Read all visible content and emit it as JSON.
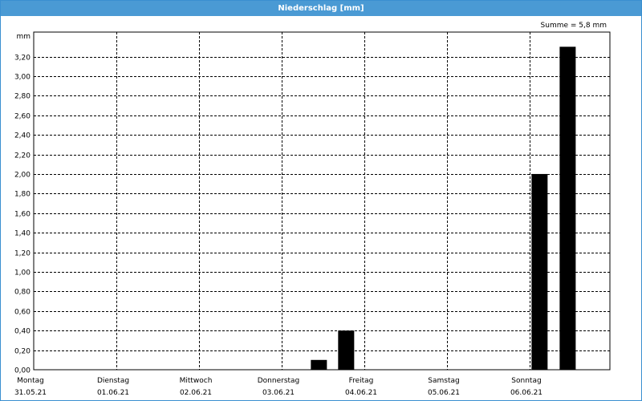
{
  "window": {
    "title": "Niederschlag [mm]"
  },
  "summary": {
    "text": "Summe = 5,8 mm"
  },
  "chart_data": {
    "type": "bar",
    "title": "Niederschlag [mm]",
    "ylabel": "mm",
    "xlabel": "",
    "ylim": [
      0,
      3.45
    ],
    "yticks": [
      "0,00",
      "0,20",
      "0,40",
      "0,60",
      "0,80",
      "1,00",
      "1,20",
      "1,40",
      "1,60",
      "1,80",
      "2,00",
      "2,20",
      "2,40",
      "2,60",
      "2,80",
      "3,00",
      "3,20"
    ],
    "grid": true,
    "days": [
      {
        "name": "Montag",
        "date": "31.05.21"
      },
      {
        "name": "Dienstag",
        "date": "01.06.21"
      },
      {
        "name": "Mittwoch",
        "date": "02.06.21"
      },
      {
        "name": "Donnerstag",
        "date": "03.06.21"
      },
      {
        "name": "Freitag",
        "date": "04.06.21"
      },
      {
        "name": "Samstag",
        "date": "05.06.21"
      },
      {
        "name": "Sonntag",
        "date": "06.06.21"
      }
    ],
    "bars": [
      {
        "day_offset": 3.45,
        "value": 0.1
      },
      {
        "day_offset": 3.78,
        "value": 0.4
      },
      {
        "day_offset": 6.12,
        "value": 2.0
      },
      {
        "day_offset": 6.46,
        "value": 3.3
      }
    ],
    "colors": {
      "bar": "#000000",
      "grid": "#000000",
      "titlebar": "#4a9ad4"
    }
  }
}
